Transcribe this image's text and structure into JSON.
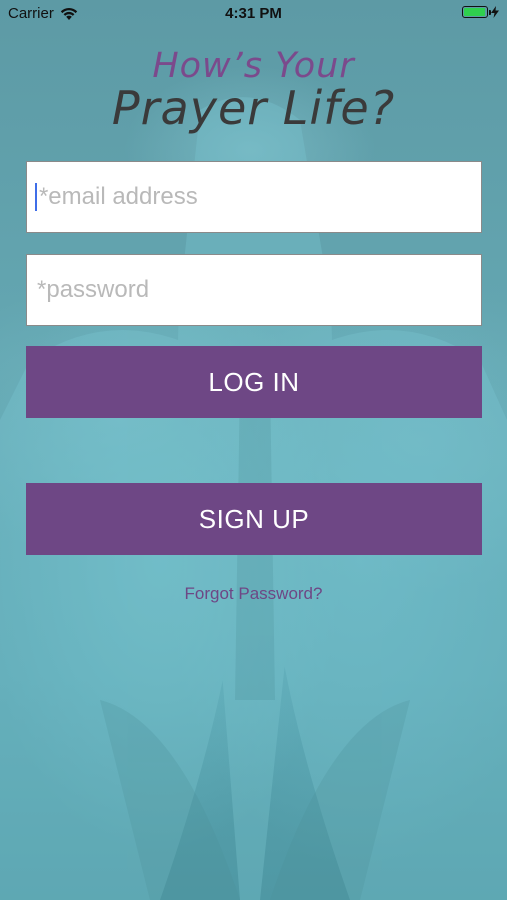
{
  "status_bar": {
    "carrier": "Carrier",
    "time": "4:31 PM",
    "battery_level": 1.0
  },
  "logo": {
    "line1": "How’s Your",
    "line2": "Prayer Life?"
  },
  "form": {
    "email_placeholder": "*email address",
    "password_placeholder": "*password",
    "login_label": "LOG IN",
    "signup_label": "SIGN UP",
    "forgot_label": "Forgot Password?"
  },
  "colors": {
    "accent": "#6e4785",
    "background": "#5f9fa9",
    "logo_purple": "#7b4a8c",
    "battery_green": "#2fcf4e",
    "cursor_blue": "#3f6ee8"
  }
}
